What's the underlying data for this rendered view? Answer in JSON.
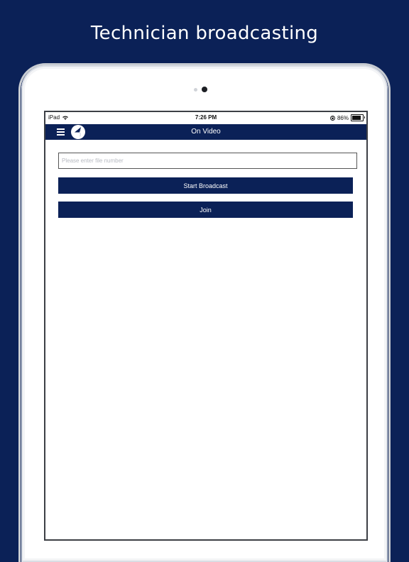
{
  "headline": "Technician broadcasting",
  "statusbar": {
    "device": "iPad",
    "time": "7:26 PM",
    "battery_percent": "86%",
    "battery_level": 0.86,
    "wifi_icon": "wifi-icon",
    "orientation_icon": "orientation-lock-icon"
  },
  "navbar": {
    "title": "On Video",
    "menu_icon": "hamburger-menu-icon",
    "logo_icon": "app-logo-icon"
  },
  "form": {
    "file_number_value": "",
    "file_number_placeholder": "Please enter file number",
    "start_label": "Start Broadcast",
    "join_label": "Join"
  },
  "colors": {
    "brand": "#0b2157",
    "background": "#0b2157",
    "screen": "#ffffff"
  }
}
